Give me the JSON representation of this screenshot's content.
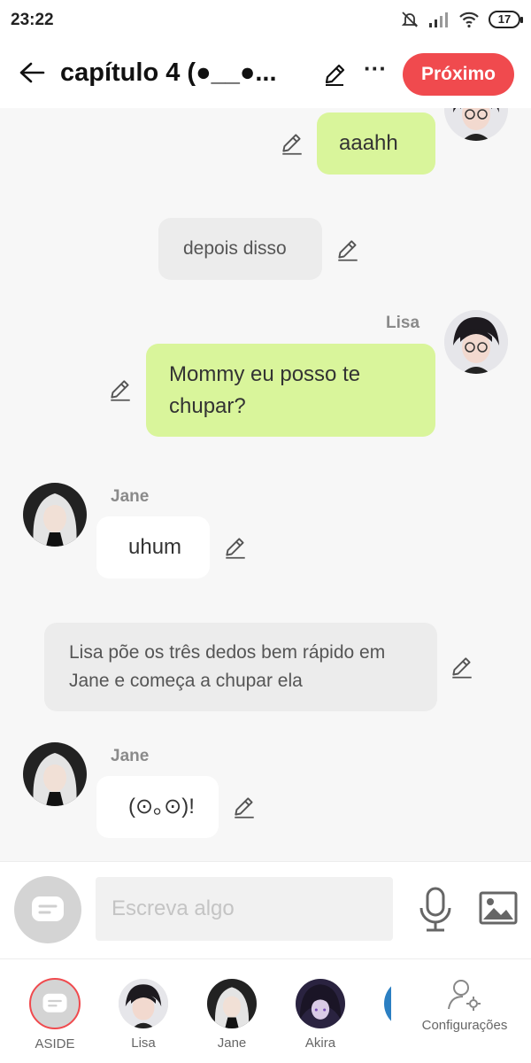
{
  "status_bar": {
    "time": "23:22",
    "battery": "17"
  },
  "header": {
    "title": "capítulo 4   (●__●...",
    "next_label": "Próximo"
  },
  "messages": [
    {
      "type": "user",
      "sender": "",
      "text": "aaahh"
    },
    {
      "type": "narration",
      "text": "depois disso"
    },
    {
      "type": "user",
      "sender": "Lisa",
      "text": "Mommy eu posso te chupar?"
    },
    {
      "type": "character",
      "sender": "Jane",
      "text": "uhum"
    },
    {
      "type": "narration",
      "text": "Lisa põe os três dedos bem rápido em Jane e começa a chupar ela"
    },
    {
      "type": "character",
      "sender": "Jane",
      "text": "(⊙｡⊙)!"
    }
  ],
  "composer": {
    "placeholder": "Escreva algo"
  },
  "tabs": [
    {
      "label": "ASIDE"
    },
    {
      "label": "Lisa"
    },
    {
      "label": "Jane"
    },
    {
      "label": "Akira"
    },
    {
      "label": "Configurações"
    }
  ],
  "colors": {
    "accent": "#f04a4e",
    "user_bubble": "#d9f59b",
    "narration_bubble": "#ececec",
    "background": "#f7f7f7"
  }
}
